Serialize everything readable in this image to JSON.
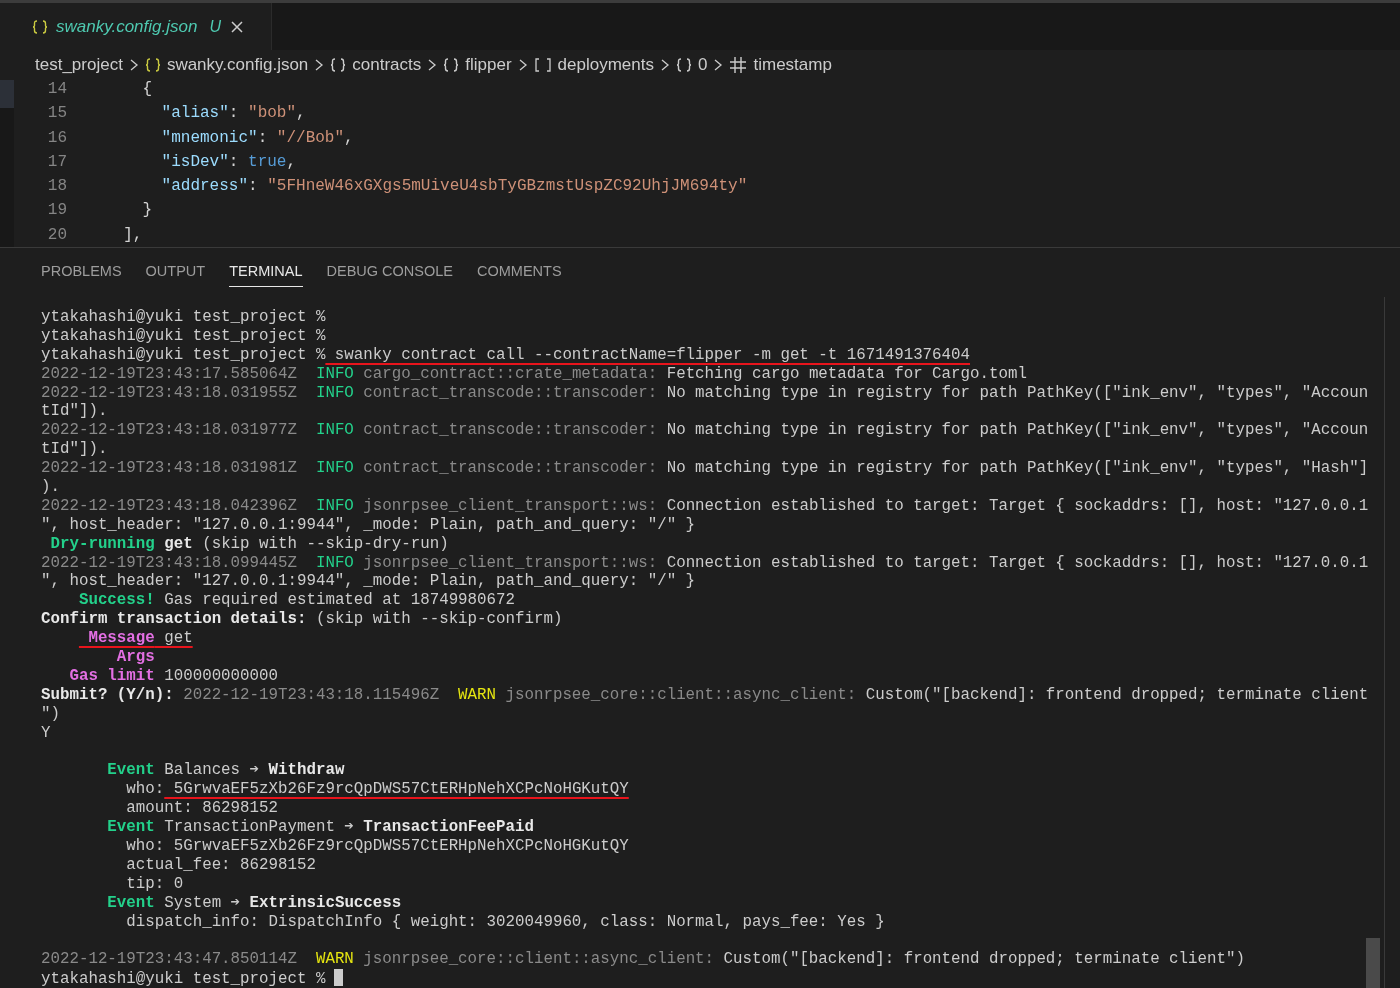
{
  "tab": {
    "file_name": "swanky.config.json",
    "status": "U",
    "selected": true
  },
  "breadcrumbs": [
    {
      "label": "test_project"
    },
    {
      "kind": "file-json",
      "label": "swanky.config.json"
    },
    {
      "kind": "object",
      "label": "contracts"
    },
    {
      "kind": "object",
      "label": "flipper"
    },
    {
      "kind": "array",
      "label": "deployments"
    },
    {
      "kind": "object",
      "label": "0"
    },
    {
      "kind": "number",
      "label": "timestamp"
    }
  ],
  "editor": {
    "lines": [
      {
        "number": "14",
        "tokens": [
          {
            "kind": "punct",
            "text": "    {"
          }
        ]
      },
      {
        "number": "15",
        "tokens": [
          {
            "kind": "key",
            "text": "      \"alias\""
          },
          {
            "kind": "punct",
            "text": ": "
          },
          {
            "kind": "string",
            "text": "\"bob\""
          },
          {
            "kind": "punct",
            "text": ","
          }
        ]
      },
      {
        "number": "16",
        "tokens": [
          {
            "kind": "key",
            "text": "      \"mnemonic\""
          },
          {
            "kind": "punct",
            "text": ": "
          },
          {
            "kind": "string",
            "text": "\"//Bob\""
          },
          {
            "kind": "punct",
            "text": ","
          }
        ]
      },
      {
        "number": "17",
        "tokens": [
          {
            "kind": "key",
            "text": "      \"isDev\""
          },
          {
            "kind": "punct",
            "text": ": "
          },
          {
            "kind": "bool",
            "text": "true"
          },
          {
            "kind": "punct",
            "text": ","
          }
        ]
      },
      {
        "number": "18",
        "tokens": [
          {
            "kind": "key",
            "text": "      \"address\""
          },
          {
            "kind": "punct",
            "text": ": "
          },
          {
            "kind": "string",
            "text": "\"5FHneW46xGXgs5mUiveU4sbTyGBzmstUspZC92UhjJM694ty\""
          }
        ]
      },
      {
        "number": "19",
        "tokens": [
          {
            "kind": "punct",
            "text": "    }"
          }
        ]
      },
      {
        "number": "20",
        "tokens": [
          {
            "kind": "punct",
            "text": "  ],"
          }
        ]
      }
    ]
  },
  "panel": {
    "tabs": [
      {
        "label": "PROBLEMS",
        "selected": false
      },
      {
        "label": "OUTPUT",
        "selected": false
      },
      {
        "label": "TERMINAL",
        "selected": true
      },
      {
        "label": "DEBUG CONSOLE",
        "selected": false
      },
      {
        "label": "COMMENTS",
        "selected": false
      }
    ]
  },
  "terminal": {
    "cursor": true,
    "lines": [
      {
        "kind": "text",
        "segments": [
          {
            "kind": "plain",
            "text": "ytakahashi@yuki test_project %"
          }
        ]
      },
      {
        "kind": "text",
        "segments": [
          {
            "kind": "plain",
            "text": "ytakahashi@yuki test_project %"
          }
        ]
      },
      {
        "kind": "text",
        "segments": [
          {
            "kind": "plain",
            "text": "ytakahashi@yuki test_project %"
          },
          {
            "kind": "plain",
            "text": " swanky contract call --contractName=flipper -m get -t 1671491376404",
            "underline": true
          }
        ]
      },
      {
        "kind": "text",
        "segments": [
          {
            "kind": "dim",
            "text": "2022-12-19T23:43:17.585064Z  "
          },
          {
            "kind": "info",
            "text": "INFO"
          },
          {
            "kind": "dim",
            "text": " cargo_contract::crate_metadata:"
          },
          {
            "kind": "plain",
            "text": " Fetching cargo metadata for Cargo.toml"
          }
        ]
      },
      {
        "kind": "text",
        "segments": [
          {
            "kind": "dim",
            "text": "2022-12-19T23:43:18.031955Z  "
          },
          {
            "kind": "info",
            "text": "INFO"
          },
          {
            "kind": "dim",
            "text": " contract_transcode::transcoder:"
          },
          {
            "kind": "plain",
            "text": " No matching type in registry for path PathKey([\"ink_env\", \"types\", \"Accoun"
          }
        ]
      },
      {
        "kind": "text",
        "segments": [
          {
            "kind": "plain",
            "text": "tId\"])."
          }
        ]
      },
      {
        "kind": "text",
        "segments": [
          {
            "kind": "dim",
            "text": "2022-12-19T23:43:18.031977Z  "
          },
          {
            "kind": "info",
            "text": "INFO"
          },
          {
            "kind": "dim",
            "text": " contract_transcode::transcoder:"
          },
          {
            "kind": "plain",
            "text": " No matching type in registry for path PathKey([\"ink_env\", \"types\", \"Accoun"
          }
        ]
      },
      {
        "kind": "text",
        "segments": [
          {
            "kind": "plain",
            "text": "tId\"])."
          }
        ]
      },
      {
        "kind": "text",
        "segments": [
          {
            "kind": "dim",
            "text": "2022-12-19T23:43:18.031981Z  "
          },
          {
            "kind": "info",
            "text": "INFO"
          },
          {
            "kind": "dim",
            "text": " contract_transcode::transcoder:"
          },
          {
            "kind": "plain",
            "text": " No matching type in registry for path PathKey([\"ink_env\", \"types\", \"Hash\"]"
          }
        ]
      },
      {
        "kind": "text",
        "segments": [
          {
            "kind": "plain",
            "text": ")."
          }
        ]
      },
      {
        "kind": "text",
        "segments": [
          {
            "kind": "dim",
            "text": "2022-12-19T23:43:18.042396Z  "
          },
          {
            "kind": "info",
            "text": "INFO"
          },
          {
            "kind": "dim",
            "text": " jsonrpsee_client_transport::ws:"
          },
          {
            "kind": "plain",
            "text": " Connection established to target: Target { sockaddrs: [], host: \"127.0.0.1"
          }
        ]
      },
      {
        "kind": "text",
        "segments": [
          {
            "kind": "plain",
            "text": "\", host_header: \"127.0.0.1:9944\", _mode: Plain, path_and_query: \"/\" }"
          }
        ]
      },
      {
        "kind": "text",
        "segments": [
          {
            "kind": "green-bold",
            "text": " Dry-running"
          },
          {
            "kind": "bold",
            "text": " get"
          },
          {
            "kind": "plain",
            "text": " (skip with --skip-dry-run)"
          }
        ]
      },
      {
        "kind": "text",
        "segments": [
          {
            "kind": "dim",
            "text": "2022-12-19T23:43:18.099445Z  "
          },
          {
            "kind": "info",
            "text": "INFO"
          },
          {
            "kind": "dim",
            "text": " jsonrpsee_client_transport::ws:"
          },
          {
            "kind": "plain",
            "text": " Connection established to target: Target { sockaddrs: [], host: \"127.0.0.1"
          }
        ]
      },
      {
        "kind": "text",
        "segments": [
          {
            "kind": "plain",
            "text": "\", host_header: \"127.0.0.1:9944\", _mode: Plain, path_and_query: \"/\" }"
          }
        ]
      },
      {
        "kind": "text",
        "segments": [
          {
            "kind": "green-bold",
            "text": "    Success!"
          },
          {
            "kind": "plain",
            "text": " Gas required estimated at 18749980672"
          }
        ]
      },
      {
        "kind": "text",
        "segments": [
          {
            "kind": "bold",
            "text": "Confirm transaction details:"
          },
          {
            "kind": "plain",
            "text": " (skip with --skip-confirm)"
          }
        ]
      },
      {
        "kind": "text",
        "segments": [
          {
            "kind": "magenta-bold",
            "text": "     Message",
            "underline": true
          },
          {
            "kind": "plain",
            "text": " get",
            "underline": true
          }
        ]
      },
      {
        "kind": "text",
        "segments": [
          {
            "kind": "magenta-bold",
            "text": "        Args"
          }
        ]
      },
      {
        "kind": "text",
        "segments": [
          {
            "kind": "magenta-bold",
            "text": "   Gas limit"
          },
          {
            "kind": "plain",
            "text": " 100000000000"
          }
        ]
      },
      {
        "kind": "text",
        "segments": [
          {
            "kind": "bold",
            "text": "Submit? (Y/n):"
          },
          {
            "kind": "dim",
            "text": " 2022-12-19T23:43:18.115496Z  "
          },
          {
            "kind": "warn",
            "text": "WARN"
          },
          {
            "kind": "dim",
            "text": " jsonrpsee_core::client::async_client:"
          },
          {
            "kind": "plain",
            "text": " Custom(\"[backend]: frontend dropped; terminate client"
          }
        ]
      },
      {
        "kind": "text",
        "segments": [
          {
            "kind": "plain",
            "text": "\")"
          }
        ]
      },
      {
        "kind": "text",
        "segments": [
          {
            "kind": "plain",
            "text": "Y"
          }
        ]
      },
      {
        "kind": "blank"
      },
      {
        "kind": "text",
        "segments": [
          {
            "kind": "green-bold",
            "text": "       Event"
          },
          {
            "kind": "plain",
            "text": " Balances ➔ "
          },
          {
            "kind": "bold",
            "text": "Withdraw"
          }
        ]
      },
      {
        "kind": "text",
        "segments": [
          {
            "kind": "plain",
            "text": "         who:"
          },
          {
            "kind": "plain",
            "text": " 5GrwvaEF5zXb26Fz9rcQpDWS57CtERHpNehXCPcNoHGKutQY",
            "underline": true
          }
        ]
      },
      {
        "kind": "text",
        "segments": [
          {
            "kind": "plain",
            "text": "         amount: 86298152"
          }
        ]
      },
      {
        "kind": "text",
        "segments": [
          {
            "kind": "green-bold",
            "text": "       Event"
          },
          {
            "kind": "plain",
            "text": " TransactionPayment ➔ "
          },
          {
            "kind": "bold",
            "text": "TransactionFeePaid"
          }
        ]
      },
      {
        "kind": "text",
        "segments": [
          {
            "kind": "plain",
            "text": "         who: 5GrwvaEF5zXb26Fz9rcQpDWS57CtERHpNehXCPcNoHGKutQY"
          }
        ]
      },
      {
        "kind": "text",
        "segments": [
          {
            "kind": "plain",
            "text": "         actual_fee: 86298152"
          }
        ]
      },
      {
        "kind": "text",
        "segments": [
          {
            "kind": "plain",
            "text": "         tip: 0"
          }
        ]
      },
      {
        "kind": "text",
        "segments": [
          {
            "kind": "green-bold",
            "text": "       Event"
          },
          {
            "kind": "plain",
            "text": " System ➔ "
          },
          {
            "kind": "bold",
            "text": "ExtrinsicSuccess"
          }
        ]
      },
      {
        "kind": "text",
        "segments": [
          {
            "kind": "plain",
            "text": "         dispatch_info: DispatchInfo { weight: 3020049960, class: Normal, pays_fee: Yes }"
          }
        ]
      },
      {
        "kind": "blank"
      },
      {
        "kind": "text",
        "segments": [
          {
            "kind": "dim",
            "text": "2022-12-19T23:43:47.850114Z  "
          },
          {
            "kind": "warn",
            "text": "WARN"
          },
          {
            "kind": "dim",
            "text": " jsonrpsee_core::client::async_client:"
          },
          {
            "kind": "plain",
            "text": " Custom(\"[backend]: frontend dropped; terminate client\")"
          }
        ]
      },
      {
        "kind": "text",
        "segments": [
          {
            "kind": "plain",
            "text": "ytakahashi@yuki test_project %"
          }
        ]
      }
    ]
  }
}
